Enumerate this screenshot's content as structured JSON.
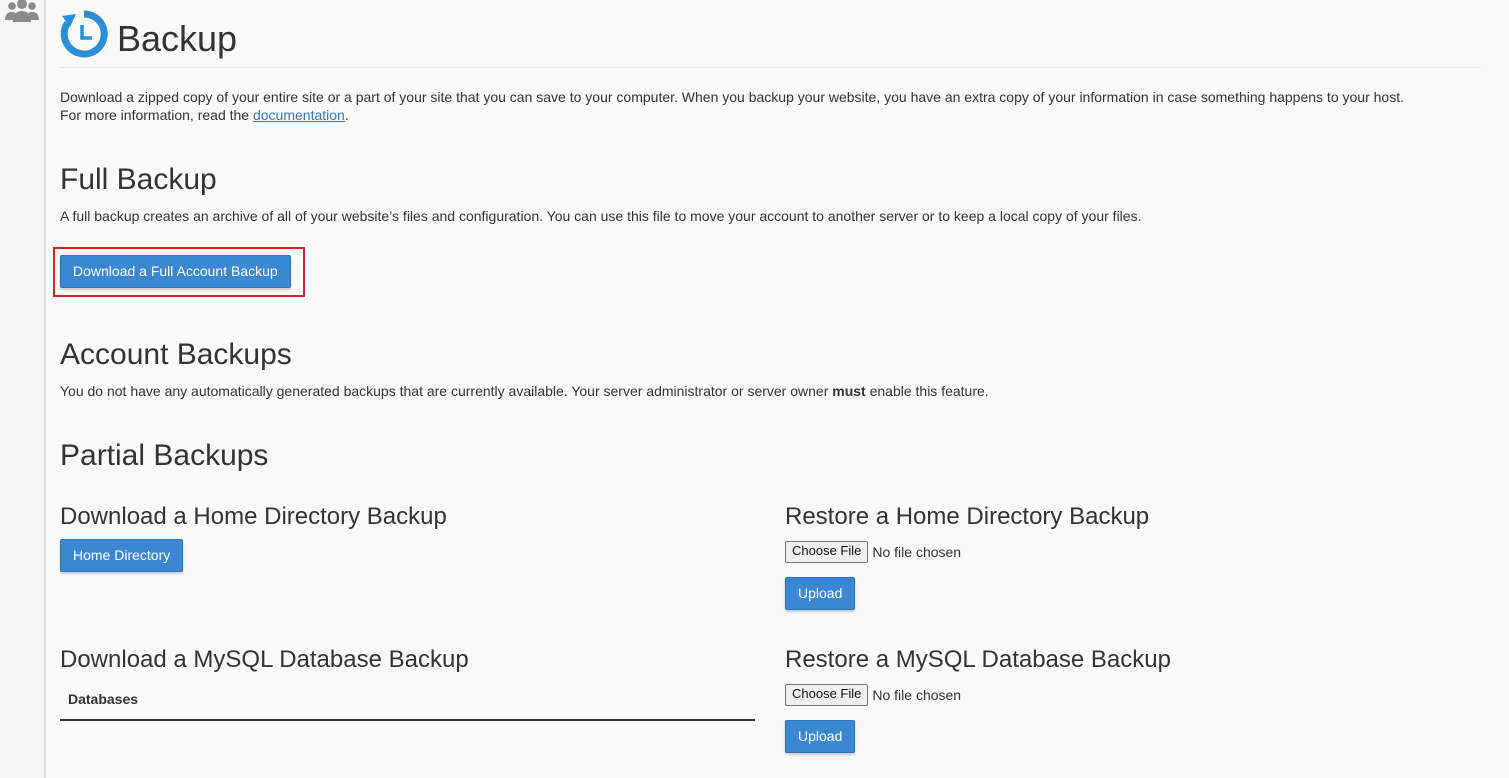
{
  "page": {
    "title": "Backup",
    "intro_text": "Download a zipped copy of your entire site or a part of your site that you can save to your computer. When you backup your website, you have an extra copy of your information in case something happens to your host.",
    "intro_more": "For more information, read the ",
    "doc_link": "documentation",
    "intro_end": "."
  },
  "full_backup": {
    "heading": "Full Backup",
    "description": "A full backup creates an archive of all of your website’s files and configuration. You can use this file to move your account to another server or to keep a local copy of your files.",
    "button": "Download a Full Account Backup"
  },
  "account_backups": {
    "heading": "Account Backups",
    "desc_before": "You do not have any automatically generated backups that are currently available. Your server administrator or server owner ",
    "desc_bold": "must",
    "desc_after": " enable this feature."
  },
  "partial_backups": {
    "heading": "Partial Backups",
    "home_download": {
      "heading": "Download a Home Directory Backup",
      "button": "Home Directory"
    },
    "home_restore": {
      "heading": "Restore a Home Directory Backup",
      "choose_file": "Choose File",
      "status": "No file chosen",
      "upload": "Upload"
    },
    "mysql_download": {
      "heading": "Download a MySQL Database Backup",
      "table_header": "Databases"
    },
    "mysql_restore": {
      "heading": "Restore a MySQL Database Backup",
      "choose_file": "Choose File",
      "status": "No file chosen",
      "upload": "Upload"
    }
  },
  "colors": {
    "accent": "#3a87d4",
    "highlight": "#e02020",
    "icon": "#2a8fd6"
  },
  "icons": {
    "sidebar": "users-icon",
    "header": "backup-clock-icon"
  }
}
